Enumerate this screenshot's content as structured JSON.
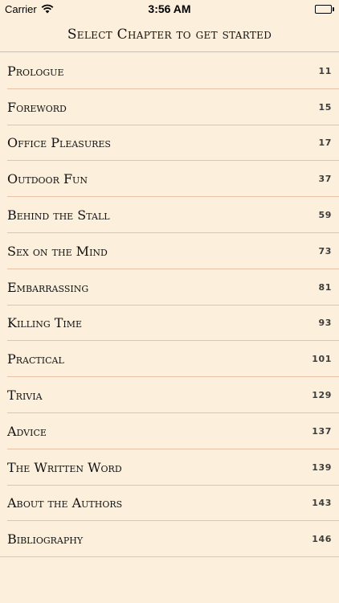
{
  "status_bar": {
    "carrier": "Carrier",
    "time": "3:56 AM",
    "wifi_icon": "wifi-icon",
    "battery_icon": "battery-icon",
    "battery_level": 1.0
  },
  "header": {
    "title": "Select Chapter to get started"
  },
  "chapters": [
    {
      "title": "Prologue",
      "page": "11"
    },
    {
      "title": "Foreword",
      "page": "15"
    },
    {
      "title": "Office Pleasures",
      "page": "17"
    },
    {
      "title": "Outdoor Fun",
      "page": "37"
    },
    {
      "title": "Behind the Stall",
      "page": "59"
    },
    {
      "title": "Sex on the Mind",
      "page": "73"
    },
    {
      "title": "Embarrassing",
      "page": "81"
    },
    {
      "title": "Killing Time",
      "page": "93"
    },
    {
      "title": "Practical",
      "page": "101"
    },
    {
      "title": "Trivia",
      "page": "129"
    },
    {
      "title": "Advice",
      "page": "137"
    },
    {
      "title": "The Written Word",
      "page": "139"
    },
    {
      "title": "About the Authors",
      "page": "143"
    },
    {
      "title": "Bibliography",
      "page": "146"
    }
  ],
  "colors": {
    "background": "#fcf0dc",
    "separator": "#e8c0a8",
    "page_number": "#3d3d3d"
  }
}
